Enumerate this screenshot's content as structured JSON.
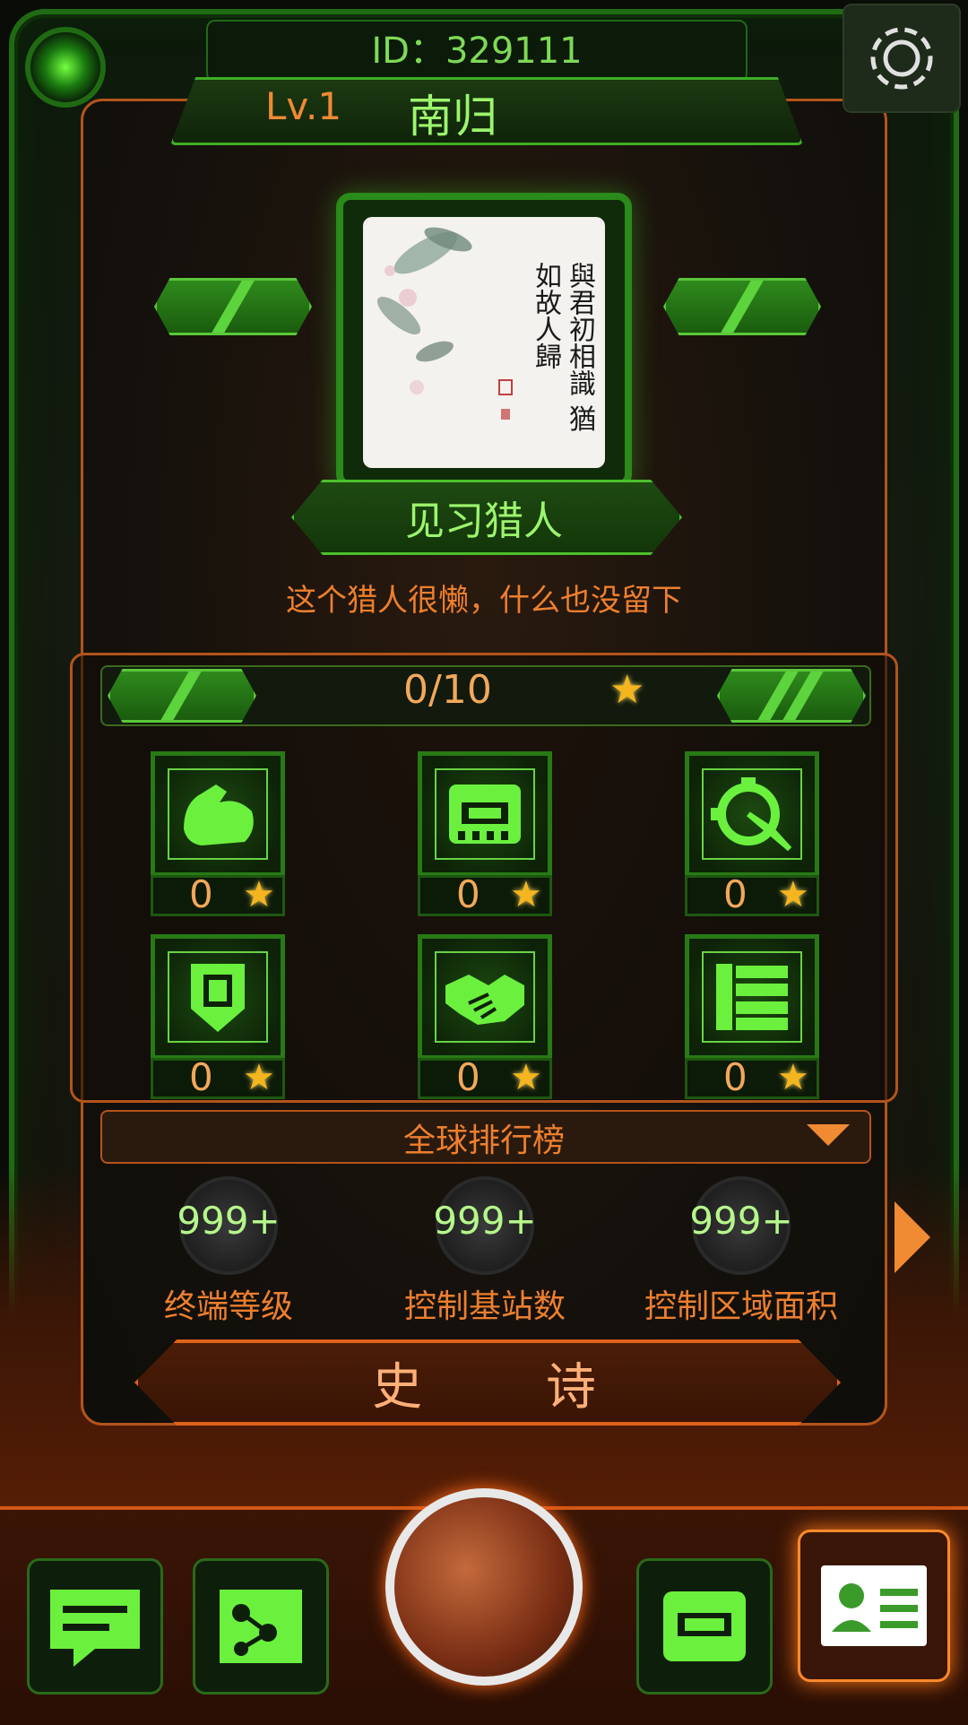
{
  "header": {
    "id_text": "ID：329111",
    "level": "Lv.1",
    "name": "南归"
  },
  "avatar": {
    "poem": "與君初相識 猶如故人歸"
  },
  "profile": {
    "rank_title": "见习猎人",
    "signature": "这个猎人很懒，什么也没留下"
  },
  "stars": {
    "count_text": "0/10",
    "star_icon": "★"
  },
  "skills": [
    {
      "icon": "strength-icon",
      "value": "0"
    },
    {
      "icon": "chip-icon",
      "value": "0"
    },
    {
      "icon": "target-icon",
      "value": "0"
    },
    {
      "icon": "shield-icon",
      "value": "0"
    },
    {
      "icon": "handshake-icon",
      "value": "0"
    },
    {
      "icon": "network-icon",
      "value": "0"
    }
  ],
  "leaderboard": {
    "label": "全球排行榜",
    "stats": [
      {
        "value": "999+",
        "label": "终端等级"
      },
      {
        "value": "999+",
        "label": "控制基站数"
      },
      {
        "value": "999+",
        "label": "控制区域面积"
      }
    ]
  },
  "epic": {
    "label": "史 诗"
  },
  "colors": {
    "green": "#4cc02c",
    "orange": "#ee7f2e",
    "star": "#f5b51f"
  }
}
